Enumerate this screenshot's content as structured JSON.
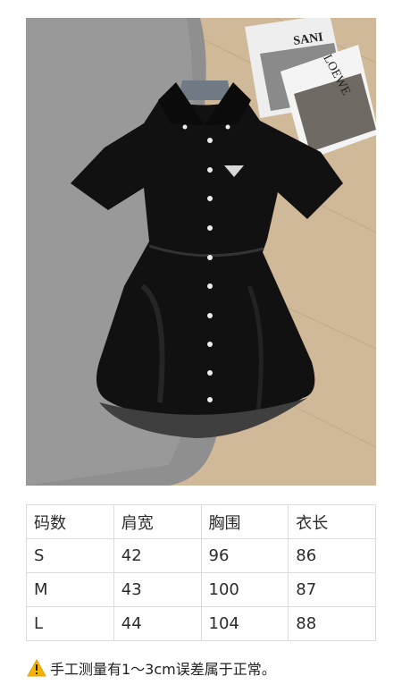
{
  "photo": {
    "magazine_1_text": "SANI",
    "magazine_2_text": "LOEWE"
  },
  "size_table": {
    "headers": [
      "码数",
      "肩宽",
      "胸围",
      "衣长"
    ],
    "rows": [
      [
        "S",
        "42",
        "96",
        "86"
      ],
      [
        "M",
        "43",
        "100",
        "87"
      ],
      [
        "L",
        "44",
        "104",
        "88"
      ]
    ]
  },
  "note": {
    "icon": "warning-icon",
    "text": "手工测量有1～3cm误差属于正常。"
  }
}
